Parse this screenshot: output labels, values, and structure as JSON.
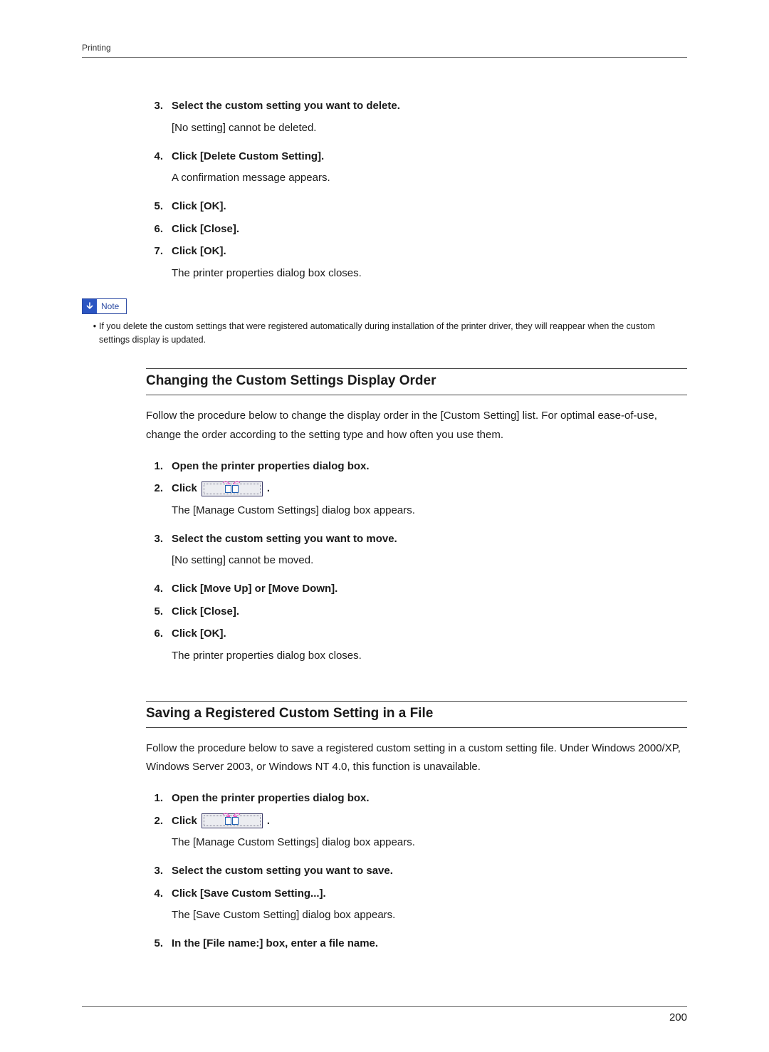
{
  "header": {
    "section_label": "Printing"
  },
  "page_number": "200",
  "note_label": "Note",
  "section0": {
    "steps": [
      {
        "n": "3.",
        "title": "Select the custom setting you want to delete.",
        "sub": "[No setting] cannot be deleted."
      },
      {
        "n": "4.",
        "title": "Click [Delete Custom Setting].",
        "sub": "A confirmation message appears."
      },
      {
        "n": "5.",
        "title": "Click [OK].",
        "sub": ""
      },
      {
        "n": "6.",
        "title": "Click [Close].",
        "sub": ""
      },
      {
        "n": "7.",
        "title": "Click [OK].",
        "sub": "The printer properties dialog box closes."
      }
    ],
    "note": "If you delete the custom settings that were registered automatically during installation of the printer driver, they will reappear when the custom settings display is updated."
  },
  "section1": {
    "heading": "Changing the Custom Settings Display Order",
    "intro": "Follow the procedure below to change the display order in the [Custom Setting] list. For optimal ease-of-use, change the order according to the setting type and how often you use them.",
    "steps": [
      {
        "n": "1.",
        "title": "Open the printer properties dialog box.",
        "sub": ""
      },
      {
        "n": "2.",
        "title_prefix": "Click",
        "title_suffix": ".",
        "sub": "The [Manage Custom Settings] dialog box appears.",
        "icon": true
      },
      {
        "n": "3.",
        "title": "Select the custom setting you want to move.",
        "sub": "[No setting] cannot be moved."
      },
      {
        "n": "4.",
        "title": "Click [Move Up] or [Move Down].",
        "sub": ""
      },
      {
        "n": "5.",
        "title": "Click [Close].",
        "sub": ""
      },
      {
        "n": "6.",
        "title": "Click [OK].",
        "sub": "The printer properties dialog box closes."
      }
    ]
  },
  "section2": {
    "heading": "Saving a Registered Custom Setting in a File",
    "intro": "Follow the procedure below to save a registered custom setting in a custom setting file. Under Windows 2000/XP, Windows Server 2003, or Windows NT 4.0, this function is unavailable.",
    "steps": [
      {
        "n": "1.",
        "title": "Open the printer properties dialog box.",
        "sub": ""
      },
      {
        "n": "2.",
        "title_prefix": "Click",
        "title_suffix": ".",
        "sub": "The [Manage Custom Settings] dialog box appears.",
        "icon": true
      },
      {
        "n": "3.",
        "title": "Select the custom setting you want to save.",
        "sub": ""
      },
      {
        "n": "4.",
        "title": "Click [Save Custom Setting...].",
        "sub": "The [Save Custom Setting] dialog box appears."
      },
      {
        "n": "5.",
        "title": "In the [File name:] box, enter a file name.",
        "sub": ""
      }
    ]
  }
}
